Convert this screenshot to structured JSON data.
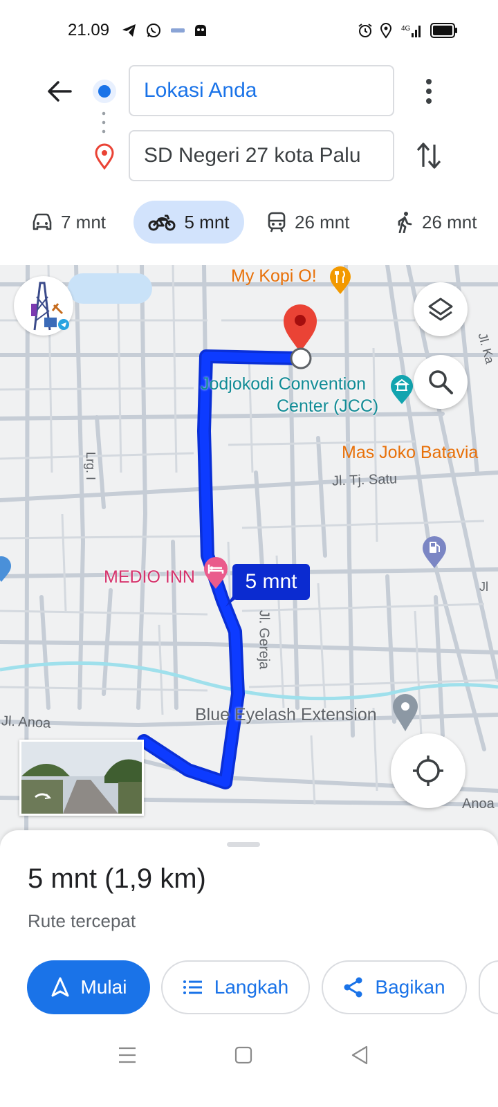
{
  "status_bar": {
    "time": "21.09",
    "left_icons": [
      "telegram-icon",
      "whatsapp-icon",
      "app-icon",
      "bird-app-icon"
    ],
    "right_icons": [
      "alarm-icon",
      "location-icon",
      "signal-4g-icon",
      "battery-icon"
    ],
    "network": "4G"
  },
  "directions": {
    "origin": "Lokasi Anda",
    "destination": "SD Negeri 27 kota Palu"
  },
  "modes": [
    {
      "name": "car",
      "time": "7 mnt",
      "selected": false
    },
    {
      "name": "motorcycle",
      "time": "5 mnt",
      "selected": true
    },
    {
      "name": "transit",
      "time": "26 mnt",
      "selected": false
    },
    {
      "name": "walk",
      "time": "26 mnt",
      "selected": false
    }
  ],
  "map": {
    "places": {
      "cafe": "My Kopi O!",
      "convention_1": "Jodjokodi Convention",
      "convention_2": "Center (JCC)",
      "restaurant": "Mas Joko Batavia",
      "hotel": "MEDIO INN",
      "salon": "Blue Eyelash Extension"
    },
    "streets": {
      "tj_satu": "Jl. Tj. Satu",
      "gereja": "Jl. Gereja",
      "anoa_left": "Jl. Anoa",
      "anoa_right": "Anoa",
      "lrg": "Lrg. I",
      "jl_ka": "Jl. Ka",
      "jl_right": "Jl"
    },
    "route_label": "5 mnt",
    "route_color": "#0d3bff"
  },
  "sheet": {
    "summary": "5 mnt (1,9 km)",
    "route_desc": "Rute tercepat",
    "start_label": "Mulai",
    "steps_label": "Langkah",
    "share_label": "Bagikan"
  },
  "colors": {
    "accent": "#1a73e8",
    "selected_mode_bg": "#d2e3fc",
    "dest_pin": "#ea4335",
    "hotel_pink": "#d6336c",
    "poi_orange": "#e8710a",
    "poi_teal": "#12a4af"
  }
}
